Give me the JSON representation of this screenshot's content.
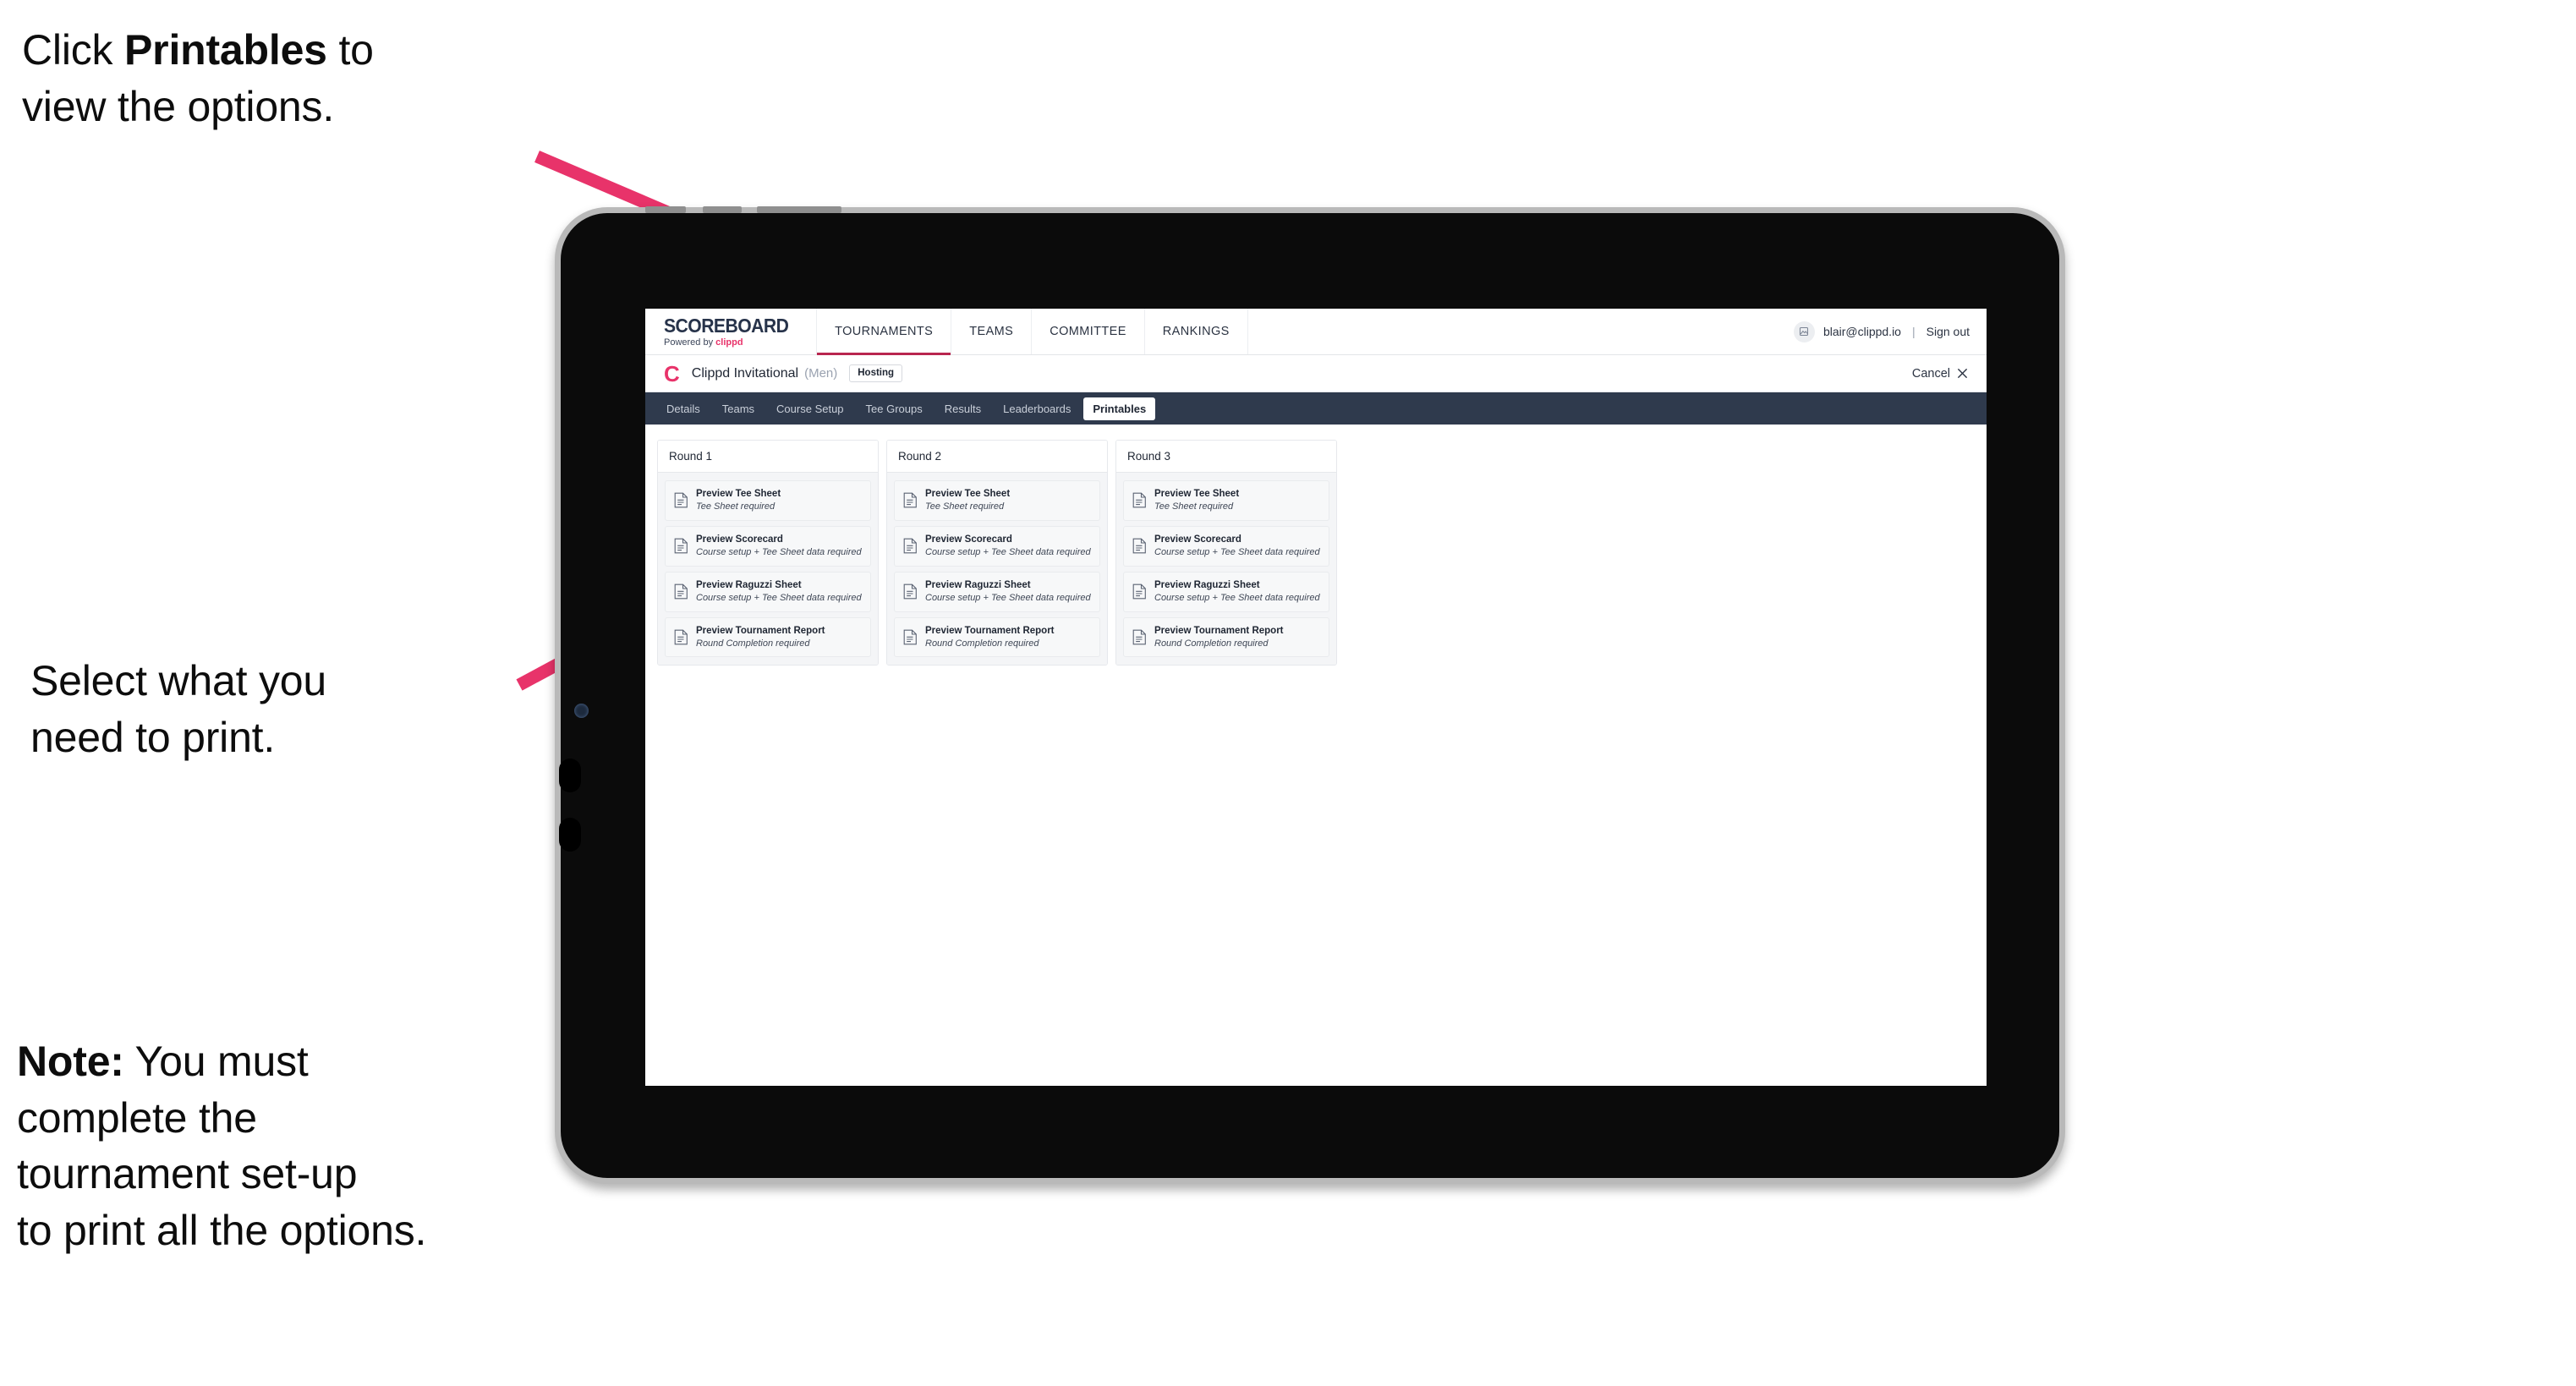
{
  "annotations": [
    {
      "id": "annot-1",
      "prefix": "Click ",
      "bold": "Printables",
      "suffix": " to\nview the options."
    },
    {
      "id": "annot-2",
      "prefix": "",
      "bold": "",
      "suffix": "Select what you\n need to print."
    },
    {
      "id": "annot-3",
      "prefix": "",
      "bold": "Note:",
      "suffix": " You must\ncomplete the\ntournament set-up\nto print all the options."
    }
  ],
  "colors": {
    "arrow": "#e8336a",
    "accent_pink": "#e8336a",
    "nav_underline": "#b8254f",
    "tabstrip_bg": "#2f3a4d",
    "text_dark": "#1f2633"
  },
  "app": {
    "brand": {
      "title": "SCOREBOARD",
      "powered_prefix": "Powered by ",
      "powered_brand": "clippd"
    },
    "nav": [
      {
        "label": "TOURNAMENTS",
        "active": true
      },
      {
        "label": "TEAMS",
        "active": false
      },
      {
        "label": "COMMITTEE",
        "active": false
      },
      {
        "label": "RANKINGS",
        "active": false
      }
    ],
    "user": {
      "avatar_icon": "user-avatar-icon",
      "email": "blair@clippd.io",
      "separator": "|",
      "sign_out": "Sign out"
    },
    "tournament_bar": {
      "logo_letter": "C",
      "name": "Clippd Invitational",
      "gender": "(Men)",
      "badge": "Hosting",
      "cancel_label": "Cancel",
      "cancel_icon": "close-icon"
    },
    "tabs": [
      {
        "label": "Details",
        "active": false
      },
      {
        "label": "Teams",
        "active": false
      },
      {
        "label": "Course Setup",
        "active": false
      },
      {
        "label": "Tee Groups",
        "active": false
      },
      {
        "label": "Results",
        "active": false
      },
      {
        "label": "Leaderboards",
        "active": false
      },
      {
        "label": "Printables",
        "active": true
      }
    ],
    "rounds": [
      {
        "title": "Round 1",
        "items": [
          {
            "title": "Preview Tee Sheet",
            "sub": "Tee Sheet required"
          },
          {
            "title": "Preview Scorecard",
            "sub": "Course setup + Tee Sheet data required"
          },
          {
            "title": "Preview Raguzzi Sheet",
            "sub": "Course setup + Tee Sheet data required"
          },
          {
            "title": "Preview Tournament Report",
            "sub": "Round Completion required"
          }
        ]
      },
      {
        "title": "Round 2",
        "items": [
          {
            "title": "Preview Tee Sheet",
            "sub": "Tee Sheet required"
          },
          {
            "title": "Preview Scorecard",
            "sub": "Course setup + Tee Sheet data required"
          },
          {
            "title": "Preview Raguzzi Sheet",
            "sub": "Course setup + Tee Sheet data required"
          },
          {
            "title": "Preview Tournament Report",
            "sub": "Round Completion required"
          }
        ]
      },
      {
        "title": "Round 3",
        "items": [
          {
            "title": "Preview Tee Sheet",
            "sub": "Tee Sheet required"
          },
          {
            "title": "Preview Scorecard",
            "sub": "Course setup + Tee Sheet data required"
          },
          {
            "title": "Preview Raguzzi Sheet",
            "sub": "Course setup + Tee Sheet data required"
          },
          {
            "title": "Preview Tournament Report",
            "sub": "Round Completion required"
          }
        ]
      }
    ]
  }
}
